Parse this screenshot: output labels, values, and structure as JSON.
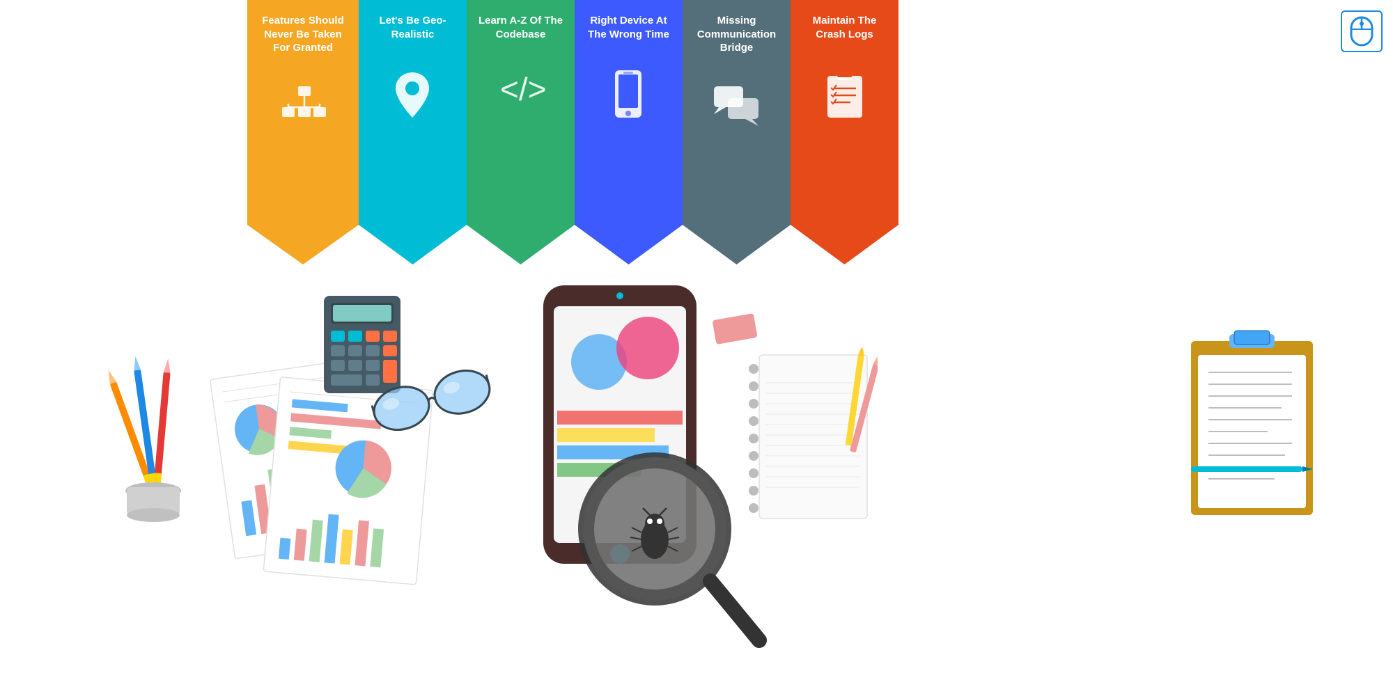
{
  "banner": {
    "items": [
      {
        "id": "features",
        "label": "Features Should Never Be Taken For Granted",
        "color": "#F5A623",
        "icon": "hierarchy"
      },
      {
        "id": "geo",
        "label": "Let's Be Geo-Realistic",
        "color": "#00BCD4",
        "icon": "location"
      },
      {
        "id": "codebase",
        "label": "Learn A-Z Of The Codebase",
        "color": "#2EAD6E",
        "icon": "code"
      },
      {
        "id": "device",
        "label": "Right Device At The Wrong Time",
        "color": "#3D5AFE",
        "icon": "phone"
      },
      {
        "id": "communication",
        "label": "Missing Communication Bridge",
        "color": "#546E7A",
        "icon": "chat"
      },
      {
        "id": "crashlogs",
        "label": "Maintain The Crash Logs",
        "color": "#E64A19",
        "icon": "clipboard"
      }
    ]
  },
  "mouse_icon": {
    "label": "🖱"
  }
}
